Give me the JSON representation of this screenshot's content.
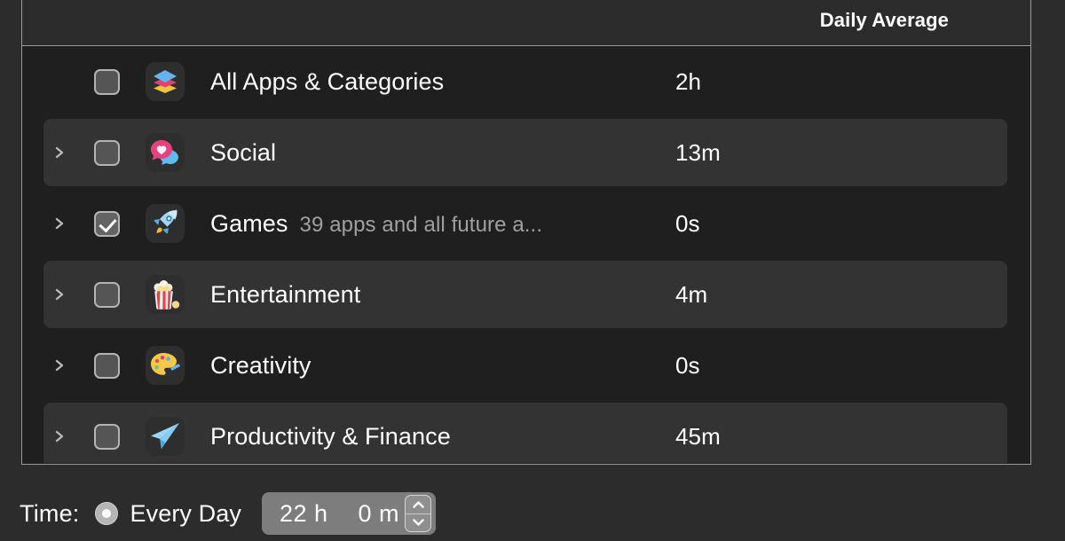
{
  "table": {
    "columns": {
      "daily_average": "Daily Average"
    },
    "rows": [
      {
        "disclosure": false,
        "checked": false,
        "icon": "stacked-layers-icon",
        "name": "All Apps & Categories",
        "subtitle": "",
        "daily_average": "2h",
        "striped": false
      },
      {
        "disclosure": true,
        "checked": false,
        "icon": "social-chat-heart-icon",
        "name": "Social",
        "subtitle": "",
        "daily_average": "13m",
        "striped": true
      },
      {
        "disclosure": true,
        "checked": true,
        "icon": "rocket-icon",
        "name": "Games",
        "subtitle": "39 apps and all future a...",
        "daily_average": "0s",
        "striped": false
      },
      {
        "disclosure": true,
        "checked": false,
        "icon": "popcorn-icon",
        "name": "Entertainment",
        "subtitle": "",
        "daily_average": "4m",
        "striped": true
      },
      {
        "disclosure": true,
        "checked": false,
        "icon": "palette-icon",
        "name": "Creativity",
        "subtitle": "",
        "daily_average": "0s",
        "striped": false
      },
      {
        "disclosure": true,
        "checked": false,
        "icon": "paper-plane-icon",
        "name": "Productivity & Finance",
        "subtitle": "",
        "daily_average": "45m",
        "striped": true
      }
    ]
  },
  "timebar": {
    "label": "Time:",
    "radio_label": "Every Day",
    "radio_selected": true,
    "hours": "22 h",
    "minutes": "0 m",
    "stepper_up": "chevron-up-icon",
    "stepper_down": "chevron-down-icon"
  },
  "colors": {
    "window_bg": "#2c2c2c",
    "table_bg": "#1f1f1f",
    "stripe_bg": "#333333",
    "border": "#9a9a9a",
    "text": "#ffffff",
    "muted_text": "#a0a0a0",
    "stepper_bg": "#7d7d7d"
  }
}
